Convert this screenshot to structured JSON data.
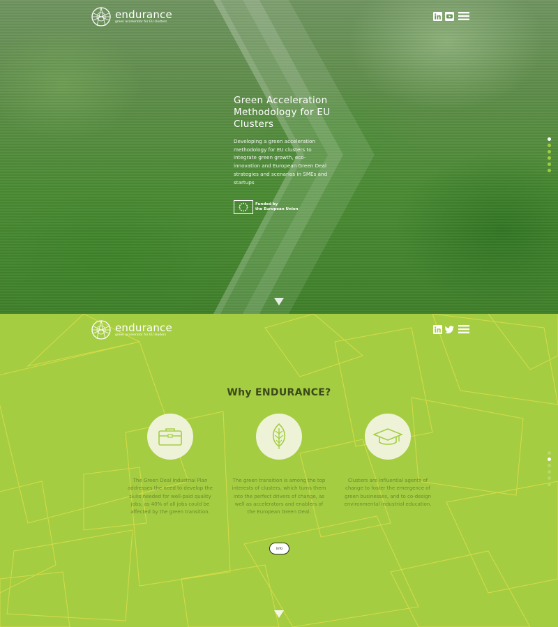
{
  "hero": {
    "logo": {
      "name": "endurance",
      "tagline": "green accelerator for EU clusters"
    },
    "social": [
      "linkedin-icon",
      "youtube-icon",
      "menu-icon"
    ],
    "title": "Green Acceleration Methodology for EU Clusters",
    "description": "Developing a green acceleration methodology for EU clusters to integrate green growth, eco-innovation and European Green Deal strategies and scenarios in SMEs and startups",
    "funding": {
      "line1": "Funded by",
      "line2": "the European Union"
    },
    "dots": [
      "#ffffff",
      "#9fcf3c",
      "#9fcf3c",
      "#9fcf3c",
      "#9fcf3c",
      "#9fcf3c",
      "#9fcf3c",
      "#9fcf3c"
    ]
  },
  "why": {
    "logo": {
      "name": "endurance",
      "tagline": "green accelerator for EU leaders"
    },
    "social": [
      "linkedin-icon",
      "twitter-icon",
      "menu-icon"
    ],
    "title": "Why ENDURANCE?",
    "features": [
      {
        "icon": "briefcase-icon",
        "text": "The Green Deal Industrial Plan addresses the need to develop the skills needed for well-paid quality jobs, as 40% of all jobs could be affected by the green transition."
      },
      {
        "icon": "leaf-icon",
        "text": "The green transition is among the top interests of clusters, which turns them into the perfect drivers of change, as well as accelerators and enablers of the European Green Deal."
      },
      {
        "icon": "graduation-cap-icon",
        "text": "Clusters are influential agents of change to foster the emergence of green businesses, and to co-design environmental industrial education."
      }
    ],
    "button_label": "info",
    "dots_active": 1,
    "colors": {
      "background": "#a5cd42",
      "title": "#3b4a1a",
      "text": "#6d8a2d",
      "circle": "#eef3d8"
    }
  }
}
